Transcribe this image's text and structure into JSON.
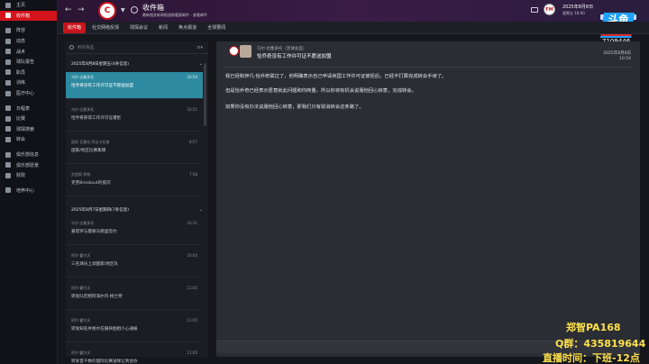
{
  "sidebar": {
    "items": [
      {
        "label": "主页",
        "icon": "home-icon"
      },
      {
        "label": "收件箱",
        "icon": "inbox-icon",
        "active": true
      },
      {
        "label": "阵容",
        "icon": "squad-icon"
      },
      {
        "label": "动态",
        "icon": "dynamics-icon"
      },
      {
        "label": "战术",
        "icon": "tactics-icon"
      },
      {
        "label": "球队报告",
        "icon": "report-icon"
      },
      {
        "label": "职员",
        "icon": "staff-icon"
      },
      {
        "label": "训练",
        "icon": "training-icon"
      },
      {
        "label": "医疗中心",
        "icon": "medical-icon"
      },
      {
        "label": "日程表",
        "icon": "calendar-icon"
      },
      {
        "label": "比赛",
        "icon": "competitions-icon"
      },
      {
        "label": "球探搜索",
        "icon": "scouting-icon"
      },
      {
        "label": "转会",
        "icon": "transfers-icon"
      },
      {
        "label": "俱乐部信息",
        "icon": "club-info-icon"
      },
      {
        "label": "俱乐部愿景",
        "icon": "club-vision-icon"
      },
      {
        "label": "财政",
        "icon": "finance-icon"
      },
      {
        "label": "培养中心",
        "icon": "development-icon"
      }
    ]
  },
  "topbar": {
    "title": "收件箱",
    "subtitle": "最新相关新闻报道和重要邮件 - 查看邮件",
    "crest_text": "C",
    "date": "2025年8月8日",
    "time": "星期五 18:00",
    "manager_badge": "FM"
  },
  "overlay": {
    "logo_main": "斗鱼",
    "logo_sub": "房间号",
    "room_number": "7109446",
    "streamer": "郑智PA168",
    "qq_group": "Q群：435819644",
    "live_time": "直播时间：下班-12点"
  },
  "tabs": [
    {
      "label": "收件箱",
      "active": true
    },
    {
      "label": "社交网络反馈"
    },
    {
      "label": "球探会议"
    },
    {
      "label": "新闻"
    },
    {
      "label": "焦点报道"
    },
    {
      "label": "全球要闻"
    }
  ],
  "list": {
    "search_placeholder": "所有筛选",
    "groups": [
      {
        "header": "2025年8月8日星期五(4条信息)",
        "messages": [
          {
            "from": "乌尔·达塞多托",
            "subject": "恰乔奇没有工作许可证不愿送加盟",
            "time": "10:54",
            "selected": true
          },
          {
            "from": "乌尔·达塞多托",
            "subject": "恰乔奇获得工作许可证遭拒",
            "time": "10:51"
          },
          {
            "from": "国家·瓦塞杜·阿达卡拉普",
            "subject": "国家/地区比赛集锦",
            "time": "8:57"
          },
          {
            "from": "克里斯·伊顿",
            "subject": "克劳Breakout的提问",
            "time": "7:58"
          }
        ]
      },
      {
        "header": "2025年8月7日星期四(7条信息)",
        "messages": [
          {
            "from": "乌尔·达塞多托",
            "subject": "嘉塔罗与曼联马德里签约",
            "time": "10:31"
          },
          {
            "from": "阿尔·霍尔沃",
            "subject": "三名球员上调国家/地区队",
            "time": "10:04"
          },
          {
            "from": "阿尔·霍尔沃",
            "subject": "转发队赶相阿海尔内·格兰特",
            "time": "11:05"
          },
          {
            "from": "阿尔·霍尔沃",
            "subject": "转发知名并格尔在摄挟图相小心通报",
            "time": "11:05"
          },
          {
            "from": "阿尔·霍尔沃",
            "subject": "转发首千数的国际比赛送球让到会协",
            "time": "11:05"
          }
        ]
      }
    ]
  },
  "detail": {
    "sender": "乌尔·达塞多托（足球总监）",
    "subject": "恰乔奇没有工作许可证不愿送加盟",
    "date": "2025年8月8日",
    "time": "10:54",
    "paragraphs": [
      "我已经和伊凡·恰乔奇联过了，他明确表示自己申请英国工作许可证被拒后，已经不打算完成转会手续了。",
      "但是恰乔奇已经表示愿意就此问题和你商量，所以你将有机会说服他回心转意，完成转会。",
      "如果你没有办法说服他回心转意，那我们只有取消转会这条路了。"
    ]
  }
}
